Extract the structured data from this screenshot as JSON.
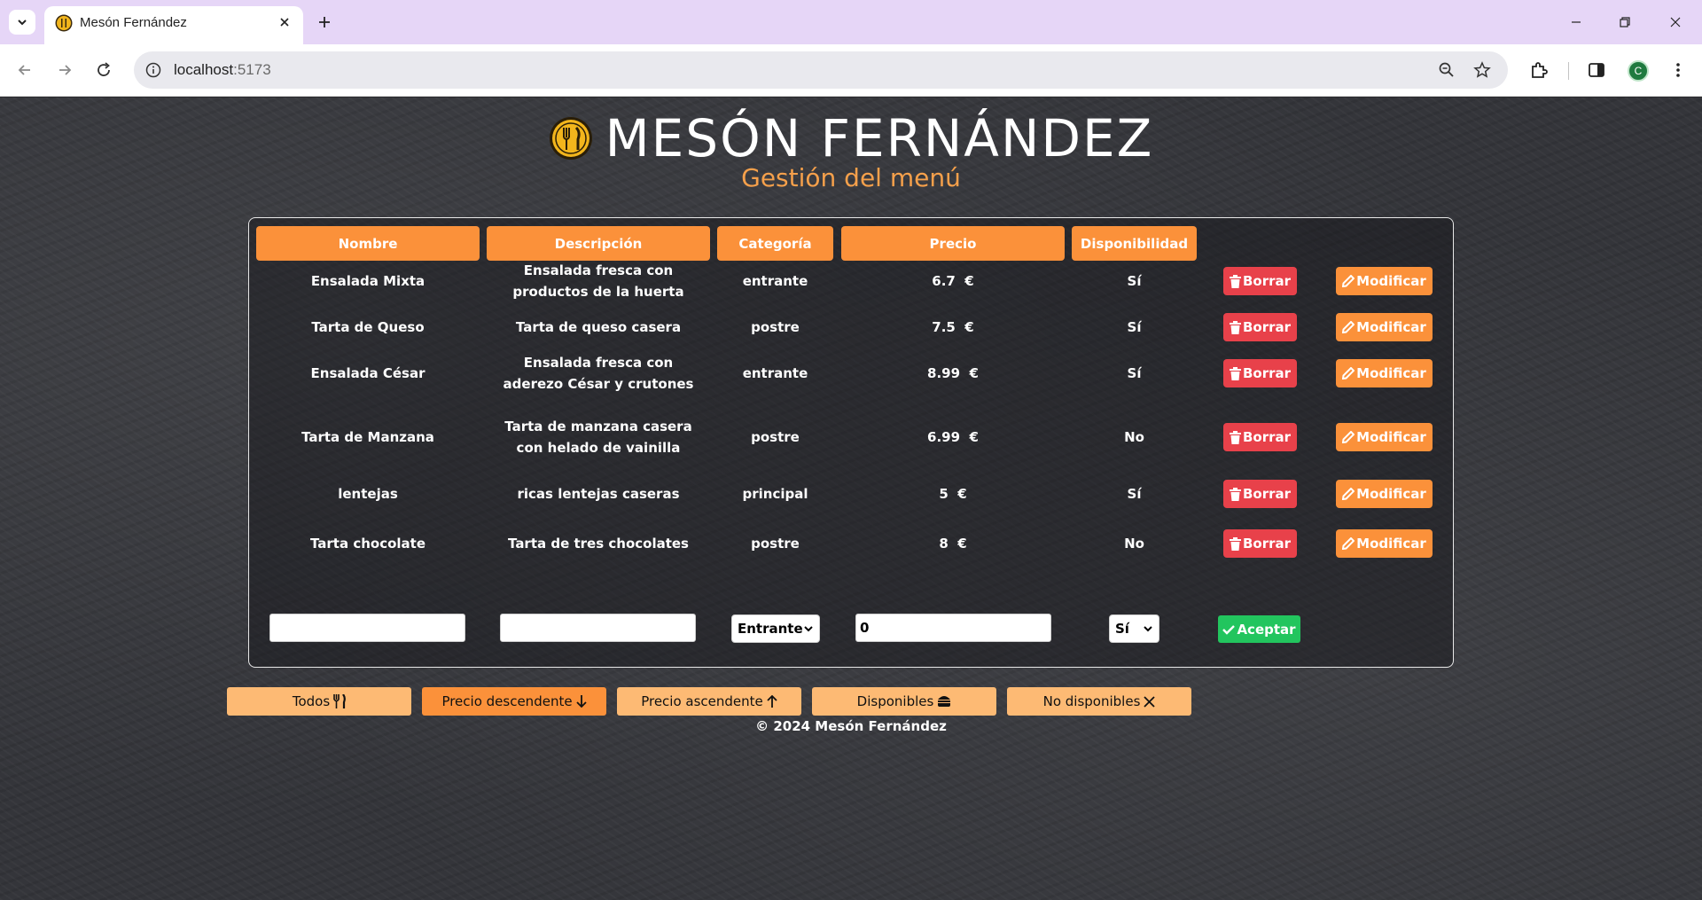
{
  "browser": {
    "tab_title": "Mesón Fernández",
    "url_host": "localhost",
    "url_port": ":5173",
    "profile_initial": "C"
  },
  "header": {
    "title": "MESÓN FERNÁNDEZ",
    "subtitle": "Gestión del menú"
  },
  "table": {
    "columns": [
      "Nombre",
      "Descripción",
      "Categoría",
      "Precio",
      "Disponibilidad"
    ],
    "delete_label": "Borrar",
    "edit_label": "Modificar",
    "currency": "€",
    "rows": [
      {
        "nombre": "Ensalada Mixta",
        "descripcion": "Ensalada fresca con productos de la huerta",
        "categoria": "entrante",
        "precio": "6.7",
        "disponible": "Sí"
      },
      {
        "nombre": "Tarta de Queso",
        "descripcion": "Tarta de queso casera",
        "categoria": "postre",
        "precio": "7.5",
        "disponible": "Sí"
      },
      {
        "nombre": "Ensalada César",
        "descripcion": "Ensalada fresca con aderezo César y crutones",
        "categoria": "entrante",
        "precio": "8.99",
        "disponible": "Sí"
      },
      {
        "nombre": "Tarta de Manzana",
        "descripcion": "Tarta de manzana casera con helado de vainilla",
        "categoria": "postre",
        "precio": "6.99",
        "disponible": "No"
      },
      {
        "nombre": "lentejas",
        "descripcion": "ricas lentejas caseras",
        "categoria": "principal",
        "precio": "5",
        "disponible": "Sí"
      },
      {
        "nombre": "Tarta chocolate",
        "descripcion": "Tarta de tres chocolates",
        "categoria": "postre",
        "precio": "8",
        "disponible": "No"
      }
    ]
  },
  "new_item_form": {
    "nombre_value": "",
    "descripcion_value": "",
    "categoria_selected": "Entrante",
    "precio_value": "0",
    "disponible_selected": "Sí",
    "accept_label": "Aceptar"
  },
  "filters": [
    {
      "label": "Todos",
      "icon": "utensils-icon",
      "active": false
    },
    {
      "label": "Precio descendente",
      "icon": "arrow-down-icon",
      "active": true
    },
    {
      "label": "Precio ascendente",
      "icon": "arrow-up-icon",
      "active": false
    },
    {
      "label": "Disponibles",
      "icon": "burger-icon",
      "active": false
    },
    {
      "label": "No disponibles",
      "icon": "x-icon",
      "active": false
    }
  ],
  "footer": {
    "text": "© 2024 Mesón Fernández"
  },
  "colors": {
    "accent_orange": "#fb913a",
    "light_orange": "#fdba74",
    "delete_red": "#e8414a",
    "accept_green": "#22c55e",
    "subtitle_orange": "#f5a04b",
    "tabbar": "#e6d6f7"
  }
}
